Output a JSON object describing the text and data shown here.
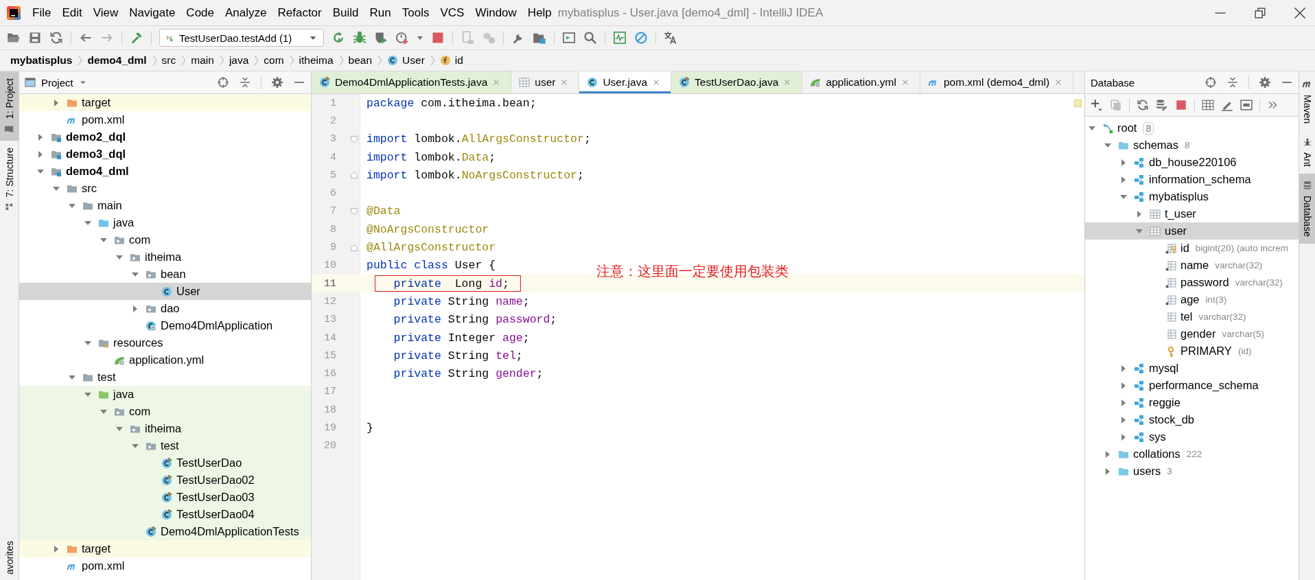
{
  "window": {
    "title": "mybatisplus - User.java [demo4_dml] - IntelliJ IDEA"
  },
  "menu": [
    "File",
    "Edit",
    "View",
    "Navigate",
    "Code",
    "Analyze",
    "Refactor",
    "Build",
    "Run",
    "Tools",
    "VCS",
    "Window",
    "Help"
  ],
  "toolbar": {
    "run_config": "TestUserDao.testAdd (1)"
  },
  "breadcrumb": [
    {
      "label": "mybatisplus",
      "kind": "module"
    },
    {
      "label": "demo4_dml",
      "kind": "module"
    },
    {
      "label": "src",
      "kind": "folder"
    },
    {
      "label": "main",
      "kind": "folder"
    },
    {
      "label": "java",
      "kind": "folder"
    },
    {
      "label": "com",
      "kind": "folder"
    },
    {
      "label": "itheima",
      "kind": "folder"
    },
    {
      "label": "bean",
      "kind": "folder"
    },
    {
      "label": "User",
      "kind": "class"
    },
    {
      "label": "id",
      "kind": "field"
    }
  ],
  "left_stripe": [
    {
      "label": "1: Project",
      "kind": "project",
      "selected": true
    },
    {
      "label": "7: Structure",
      "kind": "structure",
      "selected": false
    },
    {
      "label": "avorites",
      "kind": "favorites",
      "selected": false
    }
  ],
  "project": {
    "title": "Project",
    "tree": [
      {
        "children": [
          {
            "label": "target",
            "kind": "excluded",
            "expanded": false,
            "selected": false
          },
          {
            "label": "pom.xml",
            "kind": "maven",
            "selected": false
          }
        ]
      },
      {
        "label": "demo2_dql",
        "kind": "module",
        "expanded": false,
        "selected": false
      },
      {
        "label": "demo3_dql",
        "kind": "module",
        "expanded": false,
        "selected": false
      },
      {
        "label": "demo4_dml",
        "kind": "module",
        "expanded": true,
        "selected": false,
        "children": [
          {
            "label": "src",
            "kind": "folder",
            "expanded": true,
            "selected": false,
            "children": [
              {
                "label": "main",
                "kind": "folder",
                "expanded": true,
                "selected": false,
                "children": [
                  {
                    "label": "java",
                    "kind": "source",
                    "expanded": true,
                    "selected": false,
                    "children": [
                      {
                        "label": "com",
                        "kind": "package",
                        "expanded": true,
                        "selected": false,
                        "children": [
                          {
                            "label": "itheima",
                            "kind": "package",
                            "expanded": true,
                            "selected": false,
                            "children": [
                              {
                                "label": "bean",
                                "kind": "package",
                                "expanded": true,
                                "selected": false,
                                "children": [
                                  {
                                    "label": "User",
                                    "kind": "class",
                                    "selected": true
                                  }
                                ]
                              },
                              {
                                "label": "dao",
                                "kind": "package",
                                "expanded": false,
                                "selected": false
                              },
                              {
                                "label": "Demo4DmlApplication",
                                "kind": "app-class",
                                "selected": false
                              }
                            ]
                          }
                        ]
                      }
                    ]
                  },
                  {
                    "label": "resources",
                    "kind": "resources",
                    "expanded": true,
                    "selected": false,
                    "children": [
                      {
                        "label": "application.yml",
                        "kind": "yaml",
                        "selected": false
                      }
                    ]
                  }
                ]
              },
              {
                "label": "test",
                "kind": "folder",
                "expanded": true,
                "selected": false,
                "children": [
                  {
                    "label": "java",
                    "kind": "test-source",
                    "expanded": true,
                    "selected": false,
                    "children": [
                      {
                        "label": "com",
                        "kind": "package",
                        "expanded": true,
                        "selected": false,
                        "children": [
                          {
                            "label": "itheima",
                            "kind": "package",
                            "expanded": true,
                            "selected": false,
                            "children": [
                              {
                                "label": "test",
                                "kind": "package",
                                "expanded": true,
                                "selected": false,
                                "children": [
                                  {
                                    "label": "TestUserDao",
                                    "kind": "test-class",
                                    "selected": false
                                  },
                                  {
                                    "label": "TestUserDao02",
                                    "kind": "test-class",
                                    "selected": false
                                  },
                                  {
                                    "label": "TestUserDao03",
                                    "kind": "test-class",
                                    "selected": false
                                  },
                                  {
                                    "label": "TestUserDao04",
                                    "kind": "test-class",
                                    "selected": false
                                  }
                                ]
                              },
                              {
                                "label": "Demo4DmlApplicationTests",
                                "kind": "test-class",
                                "selected": false
                              }
                            ]
                          }
                        ]
                      }
                    ]
                  }
                ]
              }
            ]
          },
          {
            "label": "target",
            "kind": "excluded",
            "expanded": false,
            "selected": false
          },
          {
            "label": "pom.xml",
            "kind": "maven",
            "selected": false
          }
        ]
      }
    ]
  },
  "tabs": [
    {
      "label": "Demo4DmlApplicationTests.java",
      "kind": "test-class",
      "selected": false,
      "test": true
    },
    {
      "label": "user",
      "kind": "table",
      "selected": false,
      "test": false
    },
    {
      "label": "User.java",
      "kind": "class",
      "selected": true,
      "test": false
    },
    {
      "label": "TestUserDao.java",
      "kind": "test-class",
      "selected": false,
      "test": true
    },
    {
      "label": "application.yml",
      "kind": "yaml",
      "selected": false,
      "test": false
    },
    {
      "label": "pom.xml (demo4_dml)",
      "kind": "maven",
      "selected": false,
      "test": false
    }
  ],
  "editor": {
    "lines": [
      {
        "n": "1",
        "kind": "plain",
        "current": false,
        "boxed": false,
        "indented": false,
        "tokens": [
          {
            "kind": "keyword",
            "text": "package"
          },
          {
            "kind": "plain",
            "text": " com.itheima.bean;"
          }
        ]
      },
      {
        "n": "2",
        "kind": "plain",
        "current": false,
        "boxed": false,
        "indented": false
      },
      {
        "n": "3",
        "kind": "fold-start",
        "current": false,
        "boxed": false,
        "indented": false,
        "tokens": [
          {
            "kind": "keyword",
            "text": "import"
          },
          {
            "kind": "plain",
            "text": " lombok."
          },
          {
            "kind": "type",
            "text": "AllArgsConstructor"
          },
          {
            "kind": "plain",
            "text": ";"
          }
        ]
      },
      {
        "n": "4",
        "kind": "plain",
        "current": false,
        "boxed": false,
        "indented": false,
        "tokens": [
          {
            "kind": "keyword",
            "text": "import"
          },
          {
            "kind": "plain",
            "text": " lombok."
          },
          {
            "kind": "type",
            "text": "Data"
          },
          {
            "kind": "plain",
            "text": ";"
          }
        ]
      },
      {
        "n": "5",
        "kind": "fold-end",
        "current": false,
        "boxed": false,
        "indented": false,
        "tokens": [
          {
            "kind": "keyword",
            "text": "import"
          },
          {
            "kind": "plain",
            "text": " lombok."
          },
          {
            "kind": "type",
            "text": "NoArgsConstructor"
          },
          {
            "kind": "plain",
            "text": ";"
          }
        ]
      },
      {
        "n": "6",
        "kind": "plain",
        "current": false,
        "boxed": false,
        "indented": false
      },
      {
        "n": "7",
        "kind": "fold-start",
        "current": false,
        "boxed": false,
        "indented": false,
        "tokens": [
          {
            "kind": "annotation",
            "text": "@Data"
          }
        ]
      },
      {
        "n": "8",
        "kind": "plain",
        "current": false,
        "boxed": false,
        "indented": false,
        "tokens": [
          {
            "kind": "annotation",
            "text": "@NoArgsConstructor"
          }
        ]
      },
      {
        "n": "9",
        "kind": "fold-end",
        "current": false,
        "boxed": false,
        "indented": false,
        "tokens": [
          {
            "kind": "annotation",
            "text": "@AllArgsConstructor"
          }
        ]
      },
      {
        "n": "10",
        "kind": "plain",
        "current": false,
        "boxed": false,
        "indented": false,
        "tokens": [
          {
            "kind": "keyword",
            "text": "public class"
          },
          {
            "kind": "plain",
            "text": " User {"
          }
        ]
      },
      {
        "n": "11",
        "kind": "plain",
        "current": true,
        "boxed": true,
        "indented": true,
        "tokens": [
          {
            "kind": "keyword",
            "text": "private"
          },
          {
            "kind": "plain",
            "text": "  Long "
          },
          {
            "kind": "field",
            "text": "id"
          },
          {
            "kind": "plain",
            "text": ";"
          }
        ]
      },
      {
        "n": "12",
        "kind": "plain",
        "current": false,
        "boxed": false,
        "indented": true,
        "tokens": [
          {
            "kind": "keyword",
            "text": "private"
          },
          {
            "kind": "plain",
            "text": " String "
          },
          {
            "kind": "field",
            "text": "name"
          },
          {
            "kind": "plain",
            "text": ";"
          }
        ]
      },
      {
        "n": "13",
        "kind": "plain",
        "current": false,
        "boxed": false,
        "indented": true,
        "tokens": [
          {
            "kind": "keyword",
            "text": "private"
          },
          {
            "kind": "plain",
            "text": " String "
          },
          {
            "kind": "field",
            "text": "password"
          },
          {
            "kind": "plain",
            "text": ";"
          }
        ]
      },
      {
        "n": "14",
        "kind": "plain",
        "current": false,
        "boxed": false,
        "indented": true,
        "tokens": [
          {
            "kind": "keyword",
            "text": "private"
          },
          {
            "kind": "plain",
            "text": " Integer "
          },
          {
            "kind": "field",
            "text": "age"
          },
          {
            "kind": "plain",
            "text": ";"
          }
        ]
      },
      {
        "n": "15",
        "kind": "plain",
        "current": false,
        "boxed": false,
        "indented": true,
        "tokens": [
          {
            "kind": "keyword",
            "text": "private"
          },
          {
            "kind": "plain",
            "text": " String "
          },
          {
            "kind": "field",
            "text": "tel"
          },
          {
            "kind": "plain",
            "text": ";"
          }
        ]
      },
      {
        "n": "16",
        "kind": "plain",
        "current": false,
        "boxed": false,
        "indented": true,
        "tokens": [
          {
            "kind": "keyword",
            "text": "private"
          },
          {
            "kind": "plain",
            "text": " String "
          },
          {
            "kind": "field",
            "text": "gender"
          },
          {
            "kind": "plain",
            "text": ";"
          }
        ]
      },
      {
        "n": "17",
        "kind": "plain",
        "current": false,
        "boxed": false,
        "indented": false
      },
      {
        "n": "18",
        "kind": "plain",
        "current": false,
        "boxed": false,
        "indented": false
      },
      {
        "n": "19",
        "kind": "plain",
        "current": false,
        "boxed": false,
        "indented": false,
        "tokens": [
          {
            "kind": "plain",
            "text": "}"
          }
        ]
      },
      {
        "n": "20",
        "kind": "plain",
        "current": false,
        "boxed": false,
        "indented": false
      }
    ],
    "note": "注意：这里面一定要使用包装类"
  },
  "database": {
    "title": "Database",
    "tree": [
      {
        "label": "root",
        "kind": "db-root",
        "expanded": true,
        "selected": false,
        "detail": {
          "text": "8",
          "boxed": true
        },
        "children": [
          {
            "label": "schemas",
            "kind": "db-folder",
            "expanded": true,
            "selected": false,
            "detail": {
              "text": "8",
              "boxed": false
            },
            "children": [
              {
                "label": "db_house220106",
                "kind": "schema",
                "expanded": false,
                "selected": false
              },
              {
                "label": "information_schema",
                "kind": "schema",
                "expanded": false,
                "selected": false
              },
              {
                "label": "mybatisplus",
                "kind": "schema",
                "expanded": true,
                "selected": false,
                "children": [
                  {
                    "label": "t_user",
                    "kind": "table",
                    "expanded": false,
                    "selected": false
                  },
                  {
                    "label": "user",
                    "kind": "table",
                    "expanded": true,
                    "selected": true,
                    "children": [
                      {
                        "label": "id",
                        "kind": "column-key-notnull",
                        "selected": false,
                        "detail": {
                          "text": "bigint(20) (auto increm",
                          "boxed": false
                        }
                      },
                      {
                        "label": "name",
                        "kind": "column-notnull",
                        "selected": false,
                        "detail": {
                          "text": "varchar(32)",
                          "boxed": false
                        }
                      },
                      {
                        "label": "password",
                        "kind": "column-notnull",
                        "selected": false,
                        "detail": {
                          "text": "varchar(32)",
                          "boxed": false
                        }
                      },
                      {
                        "label": "age",
                        "kind": "column-notnull",
                        "selected": false,
                        "detail": {
                          "text": "int(3)",
                          "boxed": false
                        }
                      },
                      {
                        "label": "tel",
                        "kind": "column",
                        "selected": false,
                        "detail": {
                          "text": "varchar(32)",
                          "boxed": false
                        }
                      },
                      {
                        "label": "gender",
                        "kind": "column",
                        "selected": false,
                        "detail": {
                          "text": "varchar(5)",
                          "boxed": false
                        }
                      },
                      {
                        "label": "PRIMARY",
                        "kind": "key",
                        "selected": false,
                        "detail": {
                          "text": "(id)",
                          "boxed": false
                        }
                      }
                    ]
                  }
                ]
              },
              {
                "label": "mysql",
                "kind": "schema",
                "expanded": false,
                "selected": false
              },
              {
                "label": "performance_schema",
                "kind": "schema",
                "expanded": false,
                "selected": false
              },
              {
                "label": "reggie",
                "kind": "schema",
                "expanded": false,
                "selected": false
              },
              {
                "label": "stock_db",
                "kind": "schema",
                "expanded": false,
                "selected": false
              },
              {
                "label": "sys",
                "kind": "schema",
                "expanded": false,
                "selected": false
              }
            ]
          },
          {
            "label": "collations",
            "kind": "db-folder",
            "expanded": false,
            "selected": false,
            "detail": {
              "text": "222",
              "boxed": false
            }
          },
          {
            "label": "users",
            "kind": "db-folder",
            "expanded": false,
            "selected": false,
            "detail": {
              "text": "3",
              "boxed": false
            }
          }
        ]
      }
    ]
  },
  "right_stripe": [
    {
      "label": "Maven",
      "kind": "maven",
      "selected": false
    },
    {
      "label": "Ant",
      "kind": "ant",
      "selected": false
    },
    {
      "label": "Database",
      "kind": "database",
      "selected": true
    }
  ]
}
